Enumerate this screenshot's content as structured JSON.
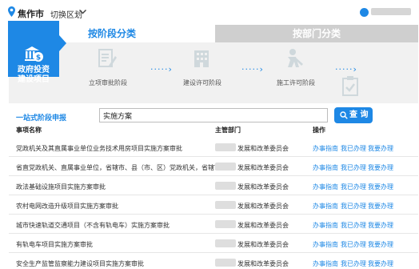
{
  "header": {
    "city": "焦作市",
    "switch_label": "切换区划"
  },
  "tabs": [
    {
      "label": "按阶段分类"
    },
    {
      "label": "按部门分类"
    }
  ],
  "stages": {
    "active_label_line1": "政府投资",
    "active_label_line2": "建设项目",
    "items": [
      {
        "label": "立项审批阶段"
      },
      {
        "label": "建设许可阶段"
      },
      {
        "label": "施工许可阶段"
      }
    ]
  },
  "search": {
    "label": "一站式阶段申报",
    "value": "实施方案",
    "button_label": "查 询"
  },
  "table": {
    "headers": {
      "name": "事项名称",
      "dept": "主管部门",
      "actions": "操作"
    },
    "action_labels": {
      "guide": "办事指南",
      "done": "我已办理",
      "apply": "我要办理"
    },
    "rows": [
      {
        "name": "党政机关及其直属事业单位业务技术用房项目实施方案审批",
        "dept": "发展和改革委员会"
      },
      {
        "name": "省直党政机关、直属事业单位，省辖市、县（市、区）党政机关，省辖市...",
        "dept": "发展和改革委员会"
      },
      {
        "name": "政法基础设施项目实施方案审批",
        "dept": "发展和改革委员会"
      },
      {
        "name": "农村电网改造升级项目实施方案审批",
        "dept": "发展和改革委员会"
      },
      {
        "name": "城市快速轨道交通项目（不含有轨电车）实施方案审批",
        "dept": "发展和改革委员会"
      },
      {
        "name": "有轨电车项目实施方案审批",
        "dept": "发展和改革委员会"
      },
      {
        "name": "安全生产监管监察能力建设项目实施方案审批",
        "dept": "发展和改革委员会"
      }
    ]
  }
}
